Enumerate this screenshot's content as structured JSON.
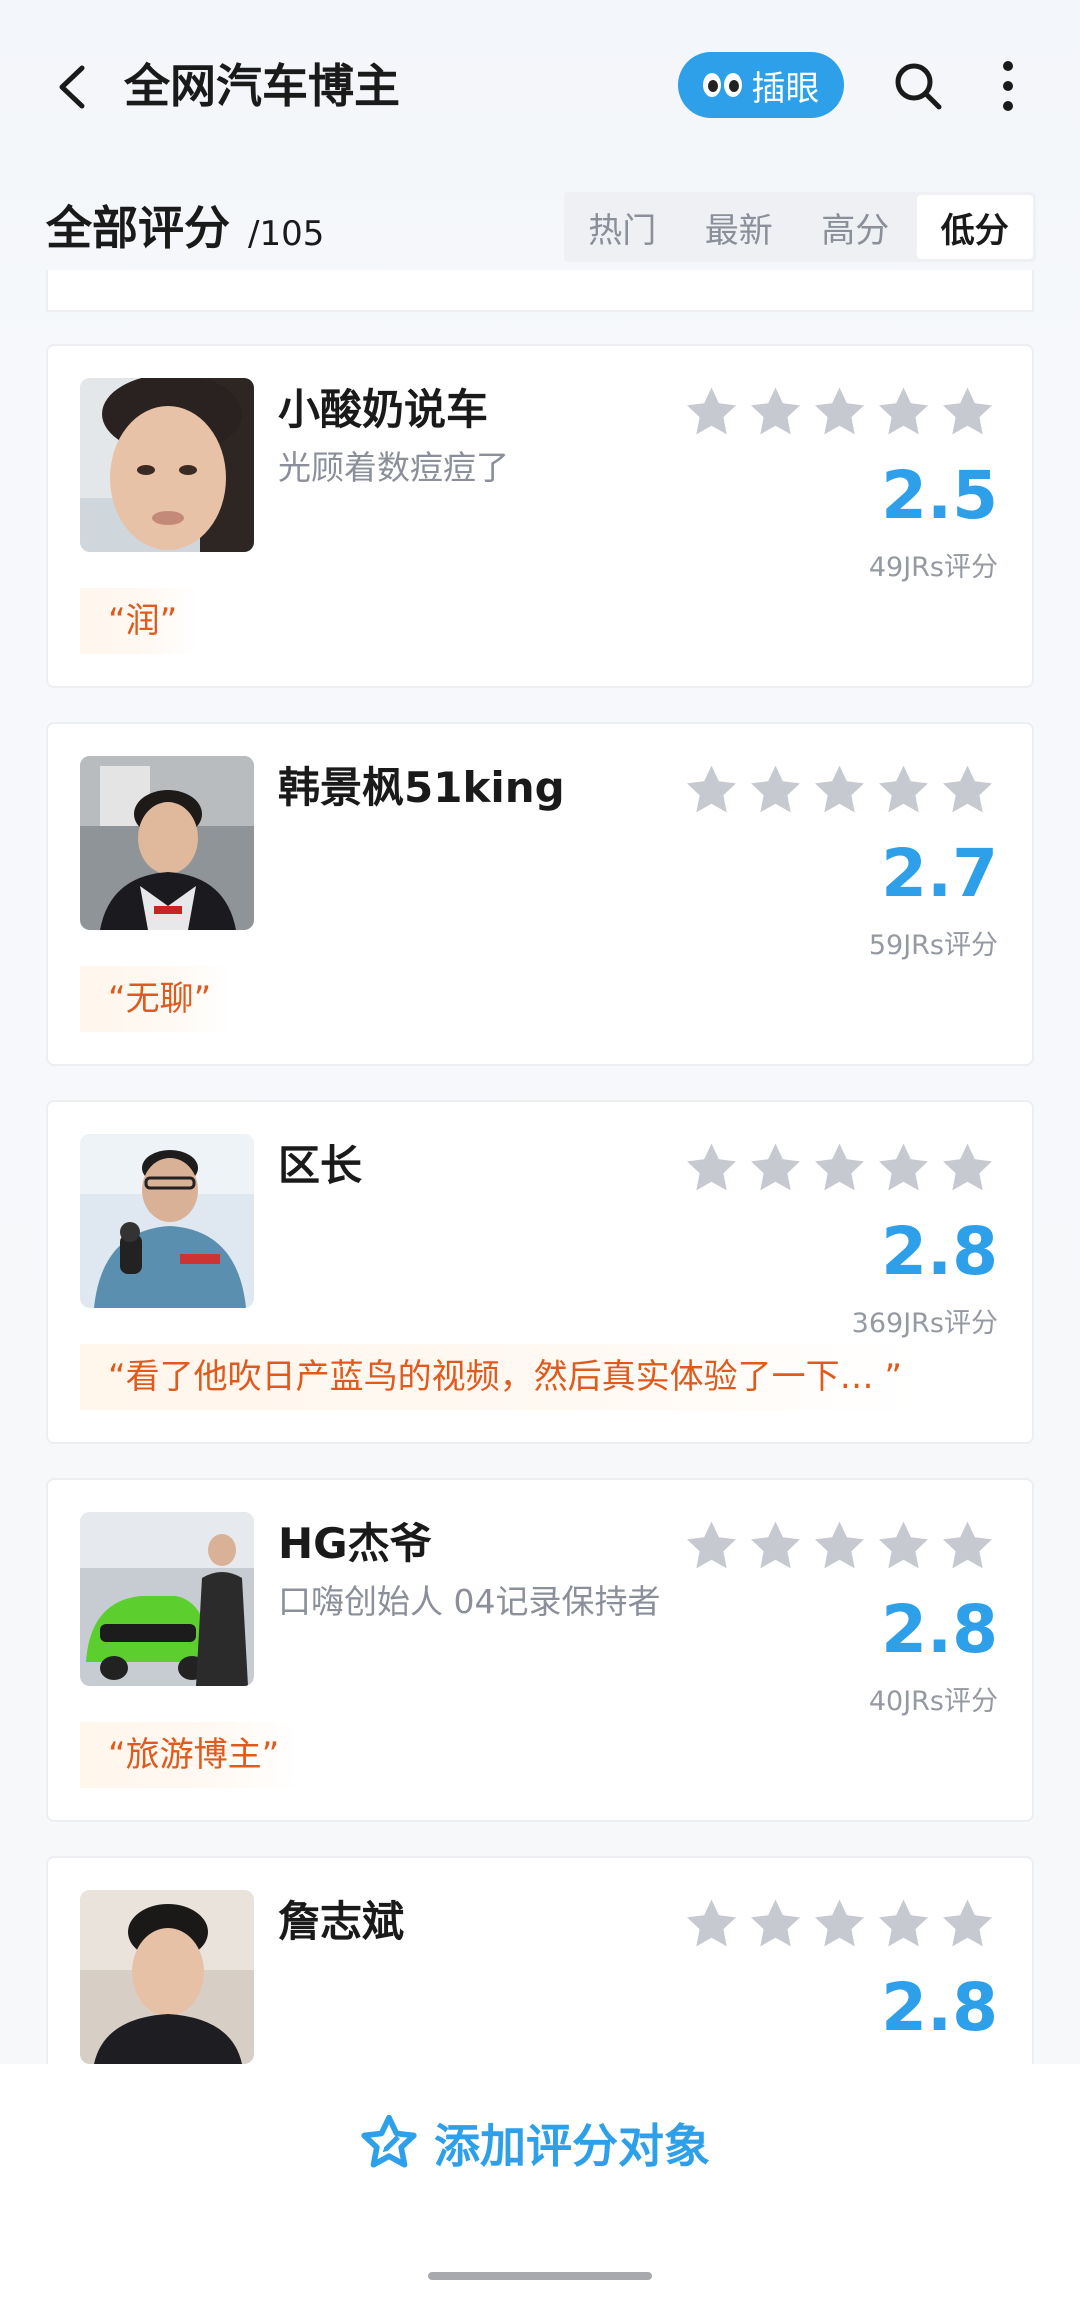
{
  "header": {
    "title": "全网汽车博主",
    "peek_label": "插眼"
  },
  "section": {
    "title": "全部评分",
    "count": "/105",
    "sort_tabs": [
      "热门",
      "最新",
      "高分",
      "低分"
    ],
    "active_tab": "低分"
  },
  "cards": [
    {
      "name": "小酸奶说车",
      "desc": "光顾着数痘痘了",
      "stars": 0,
      "score": "2.5",
      "votes": "49JRs评分",
      "comment": "“润”"
    },
    {
      "name": "韩景枫51king",
      "desc": "",
      "stars": 0,
      "score": "2.7",
      "votes": "59JRs评分",
      "comment": "“无聊”"
    },
    {
      "name": "区长",
      "desc": "",
      "stars": 0,
      "score": "2.8",
      "votes": "369JRs评分",
      "comment": "“看了他吹日产蓝鸟的视频，然后真实体验了一下… ”"
    },
    {
      "name": "HG杰爷",
      "desc": "口嗨创始人 04记录保持者",
      "stars": 0,
      "score": "2.8",
      "votes": "40JRs评分",
      "comment": "“旅游博主”"
    },
    {
      "name": "詹志斌",
      "desc": "",
      "stars": 0,
      "score": "2.8",
      "votes": "",
      "comment": ""
    }
  ],
  "bottom": {
    "add_label": "添加评分对象"
  },
  "colors": {
    "accent": "#2ea0ea",
    "comment_text": "#e05a1d",
    "star_empty": "#c7c9d0"
  }
}
